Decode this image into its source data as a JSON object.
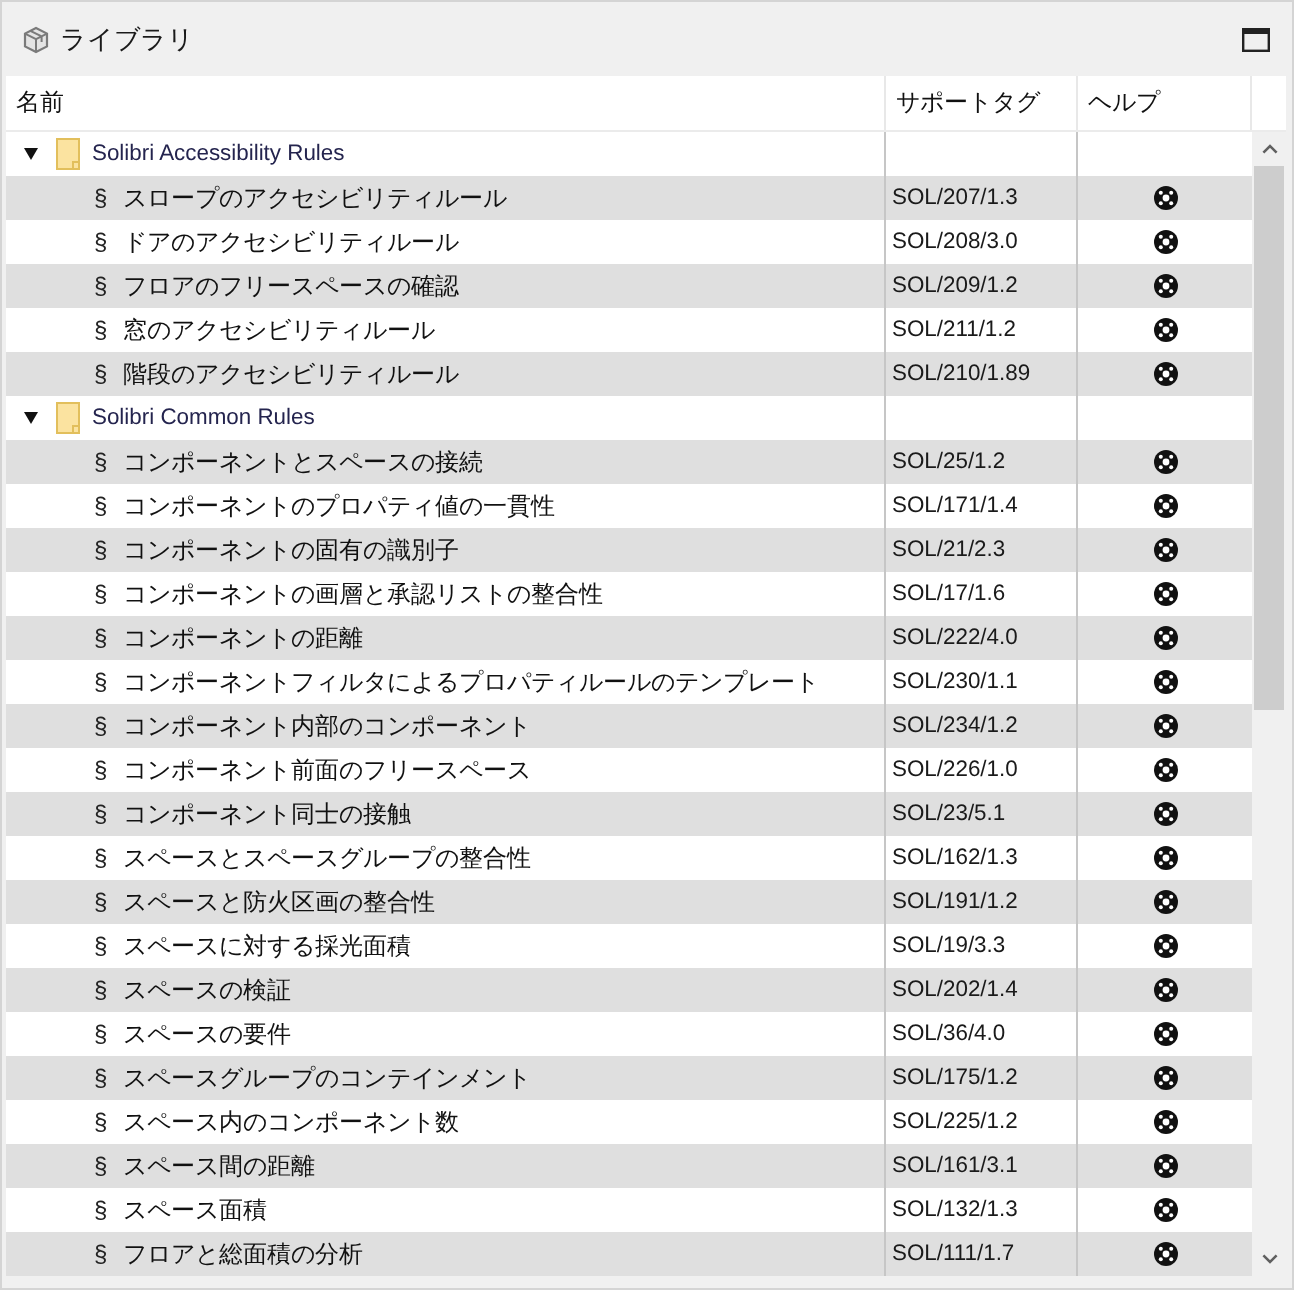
{
  "panel": {
    "title": "ライブラリ"
  },
  "table": {
    "columns": [
      "名前",
      "サポートタグ",
      "ヘルプ"
    ],
    "groups": [
      {
        "name": "Solibri Accessibility Rules",
        "expanded": true,
        "selected": false,
        "children": [
          {
            "mark": "§",
            "name": "スロープのアクセシビリティルール",
            "tag": "SOL/207/1.3",
            "selected": false
          },
          {
            "mark": "§",
            "name": "ドアのアクセシビリティルール",
            "tag": "SOL/208/3.0",
            "selected": false
          },
          {
            "mark": "§",
            "name": "フロアのフリースペースの確認",
            "tag": "SOL/209/1.2",
            "selected": false
          },
          {
            "mark": "§",
            "name": "窓のアクセシビリティルール",
            "tag": "SOL/211/1.2",
            "selected": false
          },
          {
            "mark": "§",
            "name": "階段のアクセシビリティルール",
            "tag": "SOL/210/1.89",
            "selected": false
          }
        ]
      },
      {
        "name": "Solibri Common Rules",
        "expanded": true,
        "selected": false,
        "children": [
          {
            "mark": "§",
            "name": "コンポーネントとスペースの接続",
            "tag": "SOL/25/1.2",
            "selected": false
          },
          {
            "mark": "§",
            "name": "コンポーネントのプロパティ値の一貫性",
            "tag": "SOL/171/1.4",
            "selected": false
          },
          {
            "mark": "§",
            "name": "コンポーネントの固有の識別子",
            "tag": "SOL/21/2.3",
            "selected": false
          },
          {
            "mark": "§",
            "name": "コンポーネントの画層と承認リストの整合性",
            "tag": "SOL/17/1.6",
            "selected": false
          },
          {
            "mark": "§",
            "name": "コンポーネントの距離",
            "tag": "SOL/222/4.0",
            "selected": false
          },
          {
            "mark": "§",
            "name": "コンポーネントフィルタによるプロパティルールのテンプレート",
            "tag": "SOL/230/1.1",
            "selected": false
          },
          {
            "mark": "§",
            "name": "コンポーネント内部のコンポーネント",
            "tag": "SOL/234/1.2",
            "selected": false
          },
          {
            "mark": "§",
            "name": "コンポーネント前面のフリースペース",
            "tag": "SOL/226/1.0",
            "selected": false
          },
          {
            "mark": "§",
            "name": "コンポーネント同士の接触",
            "tag": "SOL/23/5.1",
            "selected": false
          },
          {
            "mark": "§",
            "name": "スペースとスペースグループの整合性",
            "tag": "SOL/162/1.3",
            "selected": false
          },
          {
            "mark": "§",
            "name": "スペースと防火区画の整合性",
            "tag": "SOL/191/1.2",
            "selected": false
          },
          {
            "mark": "§",
            "name": "スペースに対する採光面積",
            "tag": "SOL/19/3.3",
            "selected": false
          },
          {
            "mark": "§",
            "name": "スペースの検証",
            "tag": "SOL/202/1.4",
            "selected": false
          },
          {
            "mark": "§",
            "name": "スペースの要件",
            "tag": "SOL/36/4.0",
            "selected": false
          },
          {
            "mark": "§",
            "name": "スペースグループのコンテインメント",
            "tag": "SOL/175/1.2",
            "selected": false
          },
          {
            "mark": "§",
            "name": "スペース内のコンポーネント数",
            "tag": "SOL/225/1.2",
            "selected": false
          },
          {
            "mark": "§",
            "name": "スペース間の距離",
            "tag": "SOL/161/3.1",
            "selected": false
          },
          {
            "mark": "§",
            "name": "スペース面積",
            "tag": "SOL/132/1.3",
            "selected": false
          },
          {
            "mark": "§",
            "name": "フロアと総面積の分析",
            "tag": "SOL/111/1.7",
            "selected": false
          }
        ]
      }
    ]
  }
}
